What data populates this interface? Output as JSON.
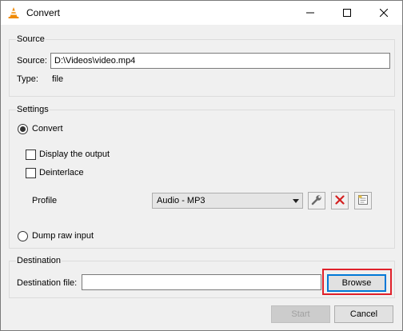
{
  "window": {
    "title": "Convert",
    "app_icon": "vlc-cone-icon",
    "controls": [
      "minimize-icon",
      "maximize-icon",
      "close-icon"
    ]
  },
  "source": {
    "group_title": "Source",
    "source_label": "Source:",
    "source_value": "D:\\Videos\\video.mp4",
    "type_label": "Type:",
    "type_value": "file"
  },
  "settings": {
    "group_title": "Settings",
    "convert_label": "Convert",
    "convert_selected": true,
    "display_output_label": "Display the output",
    "display_output_checked": false,
    "deinterlace_label": "Deinterlace",
    "deinterlace_checked": false,
    "profile_label": "Profile",
    "profile_selected": "Audio - MP3",
    "profile_icons": [
      "wrench-icon",
      "delete-x-icon",
      "new-profile-icon"
    ],
    "dump_raw_label": "Dump raw input",
    "dump_raw_selected": false
  },
  "destination": {
    "group_title": "Destination",
    "file_label": "Destination file:",
    "file_value": "",
    "browse_label": "Browse"
  },
  "buttons": {
    "start_label": "Start",
    "cancel_label": "Cancel"
  },
  "colors": {
    "accent": "#0078d7",
    "highlight": "#e0202a",
    "vlc_orange": "#f08a00",
    "delete_red": "#d42020"
  }
}
